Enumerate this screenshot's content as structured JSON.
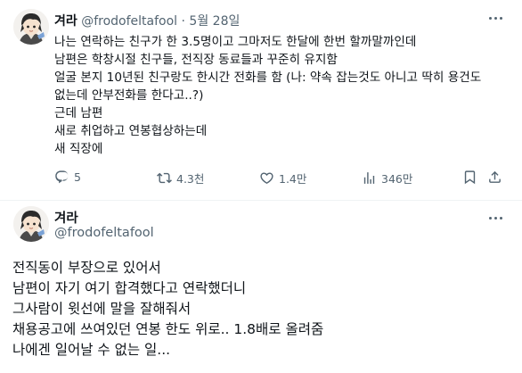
{
  "tweet1": {
    "name": "겨라",
    "handle": "@frodofeltafool",
    "separator": "·",
    "date": "5월 28일",
    "lines": [
      "나는 연락하는 친구가 한 3.5명이고 그마저도 한달에 한번 할까말까인데",
      "남편은 학창시절 친구들, 전직장 동료들과 꾸준히 유지함",
      "얼굴 본지 10년된 친구랑도 한시간 전화를 함 (나: 약속 잡는것도 아니고 딱히 용건도",
      "없는데 안부전화를 한다고..?)",
      "근데 남편",
      "새로 취업하고 연봉협상하는데",
      "새 직장에"
    ],
    "actions": {
      "reply_count": "5",
      "retweet_count": "4.3천",
      "like_count": "1.4만",
      "view_count": "346만"
    }
  },
  "tweet2": {
    "name": "겨라",
    "handle": "@frodofeltafool",
    "lines": [
      "전직동이 부장으로 있어서",
      "남편이 자기 여기 합격했다고 연락했더니",
      "그사람이 윗선에 말을 잘해줘서",
      "채용공고에 쓰여있던 연봉 한도 위로.. 1.8배로 올려줌",
      "나에겐 일어날 수 없는 일..."
    ]
  },
  "icons": {
    "reply": "reply-icon",
    "retweet": "retweet-icon",
    "like": "heart-icon",
    "views": "views-icon",
    "bookmark": "bookmark-icon",
    "share": "share-icon",
    "more": "more-icon",
    "avatar": "avatar-image"
  },
  "colors": {
    "text": "#0f1419",
    "muted": "#536471",
    "divider": "#eff3f4",
    "background": "#ffffff"
  }
}
